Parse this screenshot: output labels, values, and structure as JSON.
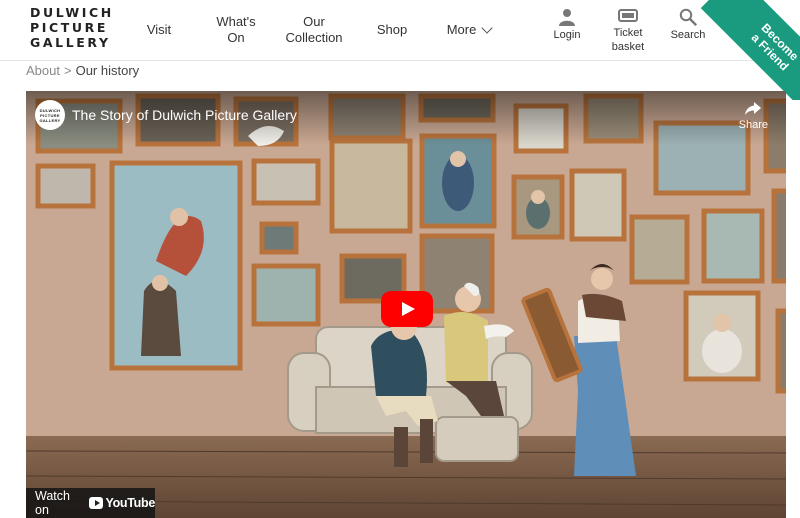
{
  "logo": {
    "line1": "DULWICH",
    "line2": "PICTURE",
    "line3": "GALLERY"
  },
  "nav": [
    {
      "line1": "Visit",
      "line2": ""
    },
    {
      "line1": "What's",
      "line2": "On"
    },
    {
      "line1": "Our",
      "line2": "Collection"
    },
    {
      "line1": "Shop",
      "line2": ""
    },
    {
      "line1": "More",
      "line2": ""
    }
  ],
  "utility": {
    "login": "Login",
    "basket_line1": "Ticket",
    "basket_line2": "basket",
    "search": "Search"
  },
  "ribbon": {
    "line1": "Become",
    "line2": "a Friend"
  },
  "breadcrumb": {
    "parent": "About",
    "separator": ">",
    "current": "Our history"
  },
  "video": {
    "title": "The Story of Dulwich Picture Gallery",
    "channel_logo": [
      "DULWICH",
      "PICTURE",
      "GALLERY"
    ],
    "share_label": "Share",
    "watch_on": "Watch on",
    "youtube": "YouTube"
  },
  "colors": {
    "ribbon": "#1a9a7f",
    "play_button": "#ff0000",
    "wall": "#c9a98f"
  }
}
